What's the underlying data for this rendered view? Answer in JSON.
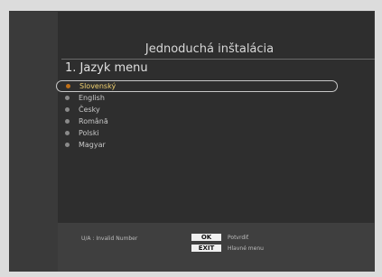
{
  "header": {
    "title": "Jednoduchá inštalácia",
    "subtitle": "1. Jazyk menu"
  },
  "menu": {
    "items": [
      {
        "label": "Slovenský",
        "selected": true
      },
      {
        "label": "English",
        "selected": false
      },
      {
        "label": "Česky",
        "selected": false
      },
      {
        "label": "Română",
        "selected": false
      },
      {
        "label": "Polski",
        "selected": false
      },
      {
        "label": "Magyar",
        "selected": false
      }
    ]
  },
  "footer": {
    "hint": "U/A : Invalid Number",
    "ok_key": "OK",
    "ok_label": "Potvrdiť",
    "exit_key": "EXIT",
    "exit_label": "Hlavné menu"
  },
  "colors": {
    "background": "#2e2e2e",
    "selected_text": "#f0d070",
    "selected_dot": "#c07018"
  }
}
